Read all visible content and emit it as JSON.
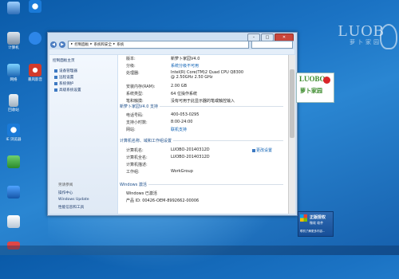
{
  "desktop": {
    "icons": [
      {
        "label": "",
        "icon": "computer-icon"
      },
      {
        "label": "",
        "icon": "ie-icon"
      },
      {
        "label": "计算机",
        "icon": "computer-icon"
      },
      {
        "label": "",
        "icon": "app-icon"
      },
      {
        "label": "网络",
        "icon": "network-icon"
      },
      {
        "label": "暴风影音",
        "icon": "player-icon"
      },
      {
        "label": "回收站",
        "icon": "recycle-bin-icon"
      },
      {
        "label": "",
        "icon": "ie-icon"
      },
      {
        "label": "IE 浏览器",
        "icon": "ie-icon"
      },
      {
        "label": "",
        "icon": "app-icon"
      },
      {
        "label": "",
        "icon": "security-icon"
      },
      {
        "label": "",
        "icon": "app-icon"
      },
      {
        "label": "",
        "icon": "app-icon"
      }
    ],
    "brand": {
      "name": "LUOB",
      "sub": "萝卜家园"
    }
  },
  "window": {
    "breadcrumb": [
      "控制面板",
      "系统和安全",
      "系统"
    ],
    "left_nav": {
      "home": "控制面板主页",
      "items": [
        "设备管理器",
        "远程设置",
        "系统保护",
        "高级系统设置"
      ],
      "see_also_title": "另请参阅",
      "see_also": [
        "操作中心",
        "Windows Update",
        "性能信息和工具"
      ]
    },
    "system": {
      "rows": [
        {
          "label": "版本:",
          "value": "新萝卜家园V4.0"
        },
        {
          "label": "分级:",
          "value": "系统分级不可用",
          "link": true
        },
        {
          "label": "处理器:",
          "value": "Intel(R) Core(TM)2 Quad CPU     Q8300\n@ 2.50GHz   2.50 GHz"
        },
        {
          "label": "安装内存(RAM):",
          "value": "2.00 GB"
        },
        {
          "label": "系统类型:",
          "value": "64 位操作系统"
        },
        {
          "label": "笔和触摸:",
          "value": "没有可用于此显示器的笔或触控输入"
        }
      ]
    },
    "support": {
      "title": "新萝卜家园V4.0 支持",
      "rows": [
        {
          "label": "电话号码:",
          "value": "400-053-0295"
        },
        {
          "label": "支持小时数:",
          "value": "8:00-24:00"
        },
        {
          "label": "网站:",
          "value": "联机支持"
        }
      ]
    },
    "computer": {
      "title": "计算机名称、域和工作组设置",
      "change_label": "更改设置",
      "rows": [
        {
          "label": "计算机名:",
          "value": "LUOBO-20140312D"
        },
        {
          "label": "计算机全名:",
          "value": "LUOBO-20140312D"
        },
        {
          "label": "计算机描述:",
          "value": ""
        },
        {
          "label": "工作组:",
          "value": "WorkGroup"
        }
      ]
    },
    "activation": {
      "title": "Windows 激活",
      "status": "Windows 已激活",
      "product_id": "产品 ID: 00426-OEM-8992662-00006",
      "genuine": {
        "line1": "正版授权",
        "line2": "微软 软件",
        "line3": "联机了解更多内容..."
      }
    },
    "logo": {
      "line1": "LUOBO",
      "line2": "萝卜家园"
    }
  },
  "colors": {
    "desktop": "#1b73c4",
    "link": "#0b5fb3",
    "close": "#c9463b"
  }
}
